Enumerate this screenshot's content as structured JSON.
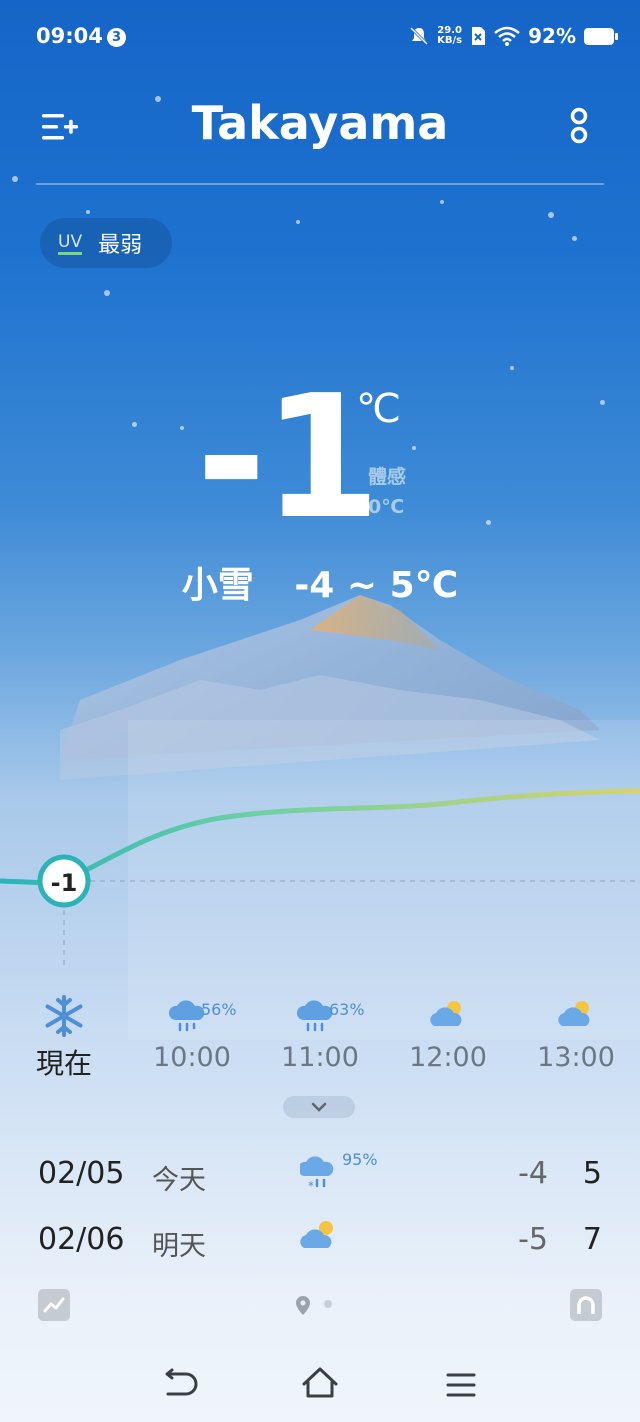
{
  "status_bar": {
    "time": "09:04",
    "notification_count": "3",
    "net_speed_value": "29.0",
    "net_speed_unit": "KB/s",
    "battery": "92%"
  },
  "header": {
    "city": "Takayama"
  },
  "uv": {
    "label": "UV",
    "value": "最弱"
  },
  "current": {
    "temperature": "-1",
    "unit": "℃",
    "feels_label": "體感",
    "feels_value": "0℃",
    "condition": "小雪",
    "range": "-4 ~ 5℃",
    "chart_badge": "-1"
  },
  "hourly": [
    {
      "label": "現在",
      "icon": "snowflake-icon",
      "pop": ""
    },
    {
      "label": "10:00",
      "icon": "rain-cloud-icon",
      "pop": "56%"
    },
    {
      "label": "11:00",
      "icon": "rain-cloud-icon",
      "pop": "63%"
    },
    {
      "label": "12:00",
      "icon": "partly-cloudy-icon",
      "pop": ""
    },
    {
      "label": "13:00",
      "icon": "partly-cloudy-icon",
      "pop": ""
    }
  ],
  "daily": [
    {
      "date": "02/05",
      "name": "今天",
      "icon": "sleet-cloud-icon",
      "pop": "95%",
      "low": "-4",
      "high": "5"
    },
    {
      "date": "02/06",
      "name": "明天",
      "icon": "partly-cloudy-icon",
      "pop": "",
      "low": "-5",
      "high": "7"
    }
  ],
  "colors": {
    "sky_top": "#1565c8",
    "accent_teal": "#2bb3b8",
    "curve_yellow": "#d9d26a",
    "pop_blue": "#4f8fd6"
  }
}
